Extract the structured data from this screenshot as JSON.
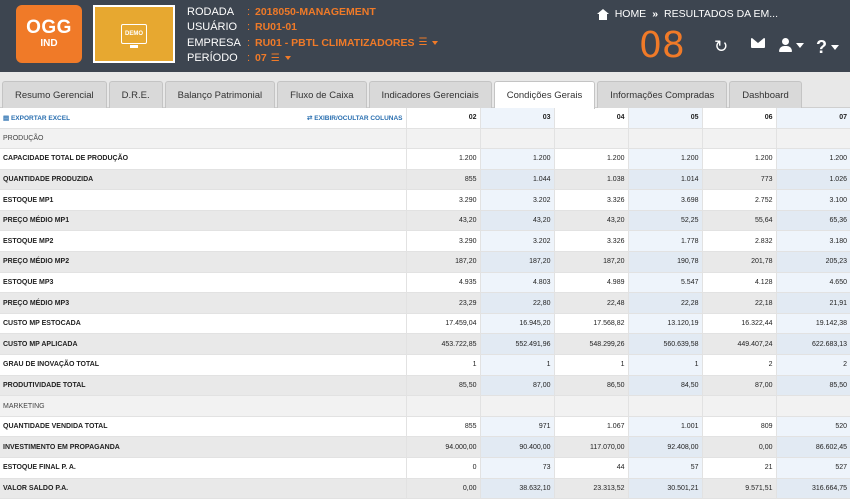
{
  "header": {
    "logo": {
      "main": "OGG",
      "sub": "IND"
    },
    "company_logo_text": "DEMO",
    "info": [
      {
        "label": "RODADA",
        "value": "2018050-MANAGEMENT"
      },
      {
        "label": "USUÁRIO",
        "value": "RU01-01"
      },
      {
        "label": "EMPRESA",
        "value": "RU01 - PBTL CLIMATIZADORES"
      },
      {
        "label": "PERÍODO",
        "value": "07"
      }
    ],
    "breadcrumb": {
      "home": "HOME",
      "separator": "»",
      "current": "RESULTADOS DA EM..."
    },
    "big_number": "08",
    "icons": {
      "refresh": "↻",
      "help": "?"
    },
    "accent_color": "#f07a28",
    "bg_color": "#3d4550"
  },
  "tabs": [
    {
      "label": "Resumo Gerencial"
    },
    {
      "label": "D.R.E."
    },
    {
      "label": "Balanço Patrimonial"
    },
    {
      "label": "Fluxo de Caixa"
    },
    {
      "label": "Indicadores Gerenciais"
    },
    {
      "label": "Condições Gerais",
      "active": true
    },
    {
      "label": "Informações Compradas"
    },
    {
      "label": "Dashboard"
    }
  ],
  "table": {
    "toolbar": {
      "export": "▤ EXPORTAR EXCEL",
      "toggle": "⇄ EXIBIR/OCULTAR COLUNAS"
    },
    "columns": [
      "02",
      "03",
      "04",
      "05",
      "06",
      "07"
    ],
    "rows": [
      {
        "label": "PRODUÇÃO",
        "section": true,
        "values": [
          "",
          "",
          "",
          "",
          "",
          ""
        ]
      },
      {
        "label": "CAPACIDADE TOTAL DE PRODUÇÃO",
        "values": [
          "1.200",
          "1.200",
          "1.200",
          "1.200",
          "1.200",
          "1.200"
        ]
      },
      {
        "label": "QUANTIDADE PRODUZIDA",
        "values": [
          "855",
          "1.044",
          "1.038",
          "1.014",
          "773",
          "1.026"
        ]
      },
      {
        "label": "ESTOQUE MP1",
        "values": [
          "3.290",
          "3.202",
          "3.326",
          "3.698",
          "2.752",
          "3.100"
        ]
      },
      {
        "label": "PREÇO MÉDIO MP1",
        "values": [
          "43,20",
          "43,20",
          "43,20",
          "52,25",
          "55,64",
          "65,36"
        ]
      },
      {
        "label": "ESTOQUE MP2",
        "values": [
          "3.290",
          "3.202",
          "3.326",
          "1.778",
          "2.832",
          "3.180"
        ]
      },
      {
        "label": "PREÇO MÉDIO MP2",
        "values": [
          "187,20",
          "187,20",
          "187,20",
          "190,78",
          "201,78",
          "205,23"
        ]
      },
      {
        "label": "ESTOQUE MP3",
        "values": [
          "4.935",
          "4.803",
          "4.989",
          "5.547",
          "4.128",
          "4.650"
        ]
      },
      {
        "label": "PREÇO MÉDIO MP3",
        "values": [
          "23,29",
          "22,80",
          "22,48",
          "22,28",
          "22,18",
          "21,91"
        ]
      },
      {
        "label": "CUSTO MP ESTOCADA",
        "values": [
          "17.459,04",
          "16.945,20",
          "17.568,82",
          "13.120,19",
          "16.322,44",
          "19.142,38"
        ]
      },
      {
        "label": "CUSTO MP APLICADA",
        "values": [
          "453.722,85",
          "552.491,96",
          "548.299,26",
          "560.639,58",
          "449.407,24",
          "622.683,13"
        ]
      },
      {
        "label": "GRAU DE INOVAÇÃO TOTAL",
        "values": [
          "1",
          "1",
          "1",
          "1",
          "2",
          "2"
        ]
      },
      {
        "label": "PRODUTIVIDADE TOTAL",
        "values": [
          "85,50",
          "87,00",
          "86,50",
          "84,50",
          "87,00",
          "85,50"
        ]
      },
      {
        "label": "MARKETING",
        "section": true,
        "values": [
          "",
          "",
          "",
          "",
          "",
          ""
        ]
      },
      {
        "label": "QUANTIDADE VENDIDA TOTAL",
        "values": [
          "855",
          "971",
          "1.067",
          "1.001",
          "809",
          "520"
        ]
      },
      {
        "label": "INVESTIMENTO EM PROPAGANDA",
        "values": [
          "94.000,00",
          "90.400,00",
          "117.070,00",
          "92.408,00",
          "0,00",
          "86.602,45"
        ]
      },
      {
        "label": "ESTOQUE FINAL P. A.",
        "values": [
          "0",
          "73",
          "44",
          "57",
          "21",
          "527"
        ]
      },
      {
        "label": "VALOR SALDO P.A.",
        "values": [
          "0,00",
          "38.632,10",
          "23.313,52",
          "30.501,21",
          "9.571,51",
          "316.664,75"
        ]
      }
    ]
  }
}
